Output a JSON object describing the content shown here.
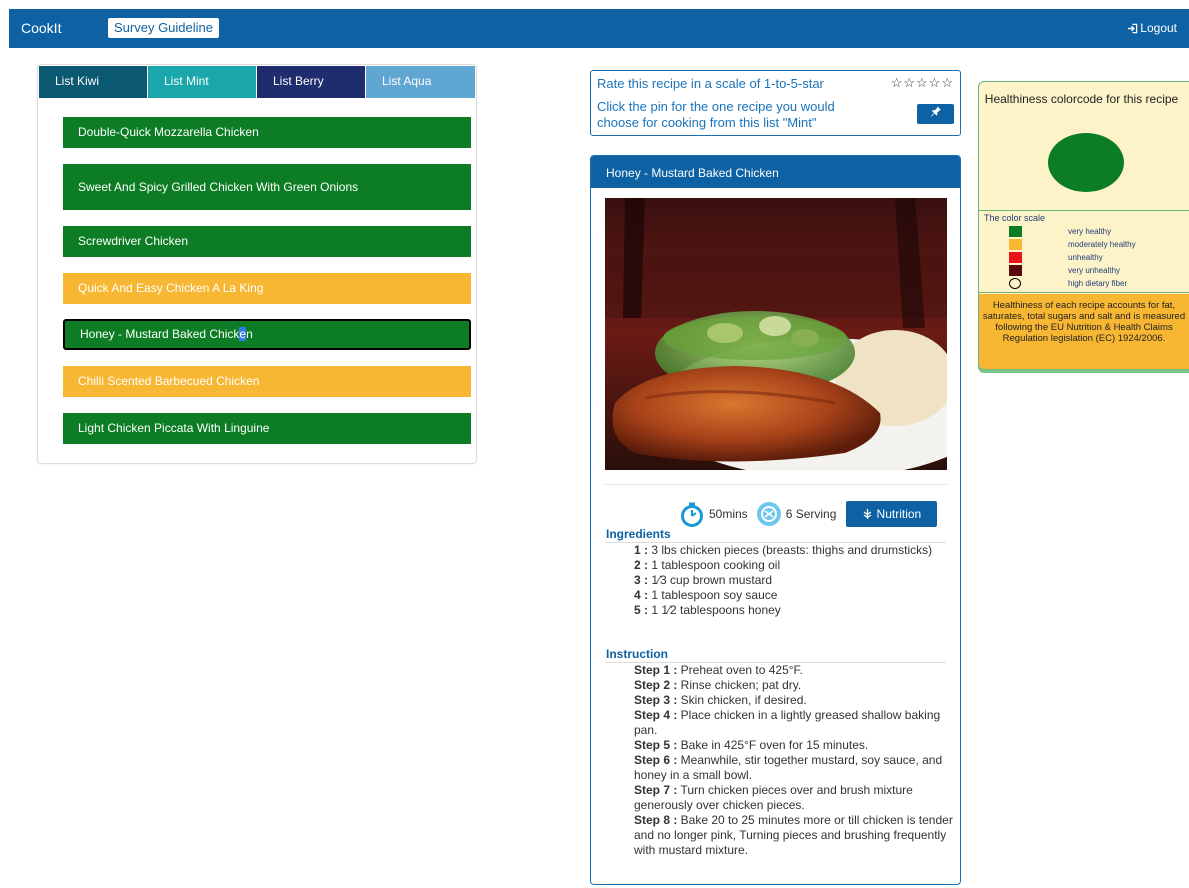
{
  "navbar": {
    "brand": "CookIt",
    "guideline_label": "Survey Guideline",
    "logout_label": "Logout"
  },
  "tabs": [
    {
      "label": "List Kiwi"
    },
    {
      "label": "List Mint"
    },
    {
      "label": "List Berry"
    },
    {
      "label": "List Aqua"
    }
  ],
  "recipes": [
    {
      "name": "Double-Quick Mozzarella Chicken",
      "health": "very healthy"
    },
    {
      "name": "Sweet And Spicy Grilled Chicken With Green Onions",
      "health": "very healthy"
    },
    {
      "name": "Screwdriver Chicken",
      "health": "very healthy"
    },
    {
      "name": "Quick And Easy Chicken A La King",
      "health": "moderately healthy"
    },
    {
      "name_part1": "Honey - Mustard Baked Chick",
      "name_highlight": "e",
      "name_part2": "n",
      "health": "very healthy",
      "selected": true
    },
    {
      "name": "Chilli Scented Barbecued Chicken",
      "health": "moderately healthy"
    },
    {
      "name": "Light Chicken Piccata With Linguine",
      "health": "very healthy"
    }
  ],
  "rating": {
    "prompt": "Rate this recipe in a scale of 1-to-5-star",
    "stars": "☆☆☆☆☆",
    "pin_prompt": "Click the pin for the one recipe you would choose for cooking from this list \"Mint\""
  },
  "recipe_card": {
    "title": "Honey - Mustard Baked Chicken",
    "time": "50mins",
    "servings": "6 Serving",
    "nutrition_label": "Nutrition",
    "ingredients_title": "Ingredients",
    "ingredients": [
      {
        "num": "1 :",
        "text": " 3 lbs chicken pieces (breasts: thighs and drumsticks)"
      },
      {
        "num": "2 :",
        "text": " 1 tablespoon cooking oil"
      },
      {
        "num": "3 :",
        "text": " 1⁄3 cup brown mustard"
      },
      {
        "num": "4 :",
        "text": " 1 tablespoon soy sauce"
      },
      {
        "num": "5 :",
        "text": " 1 1⁄2 tablespoons honey"
      }
    ],
    "instruction_title": "Instruction",
    "steps": [
      {
        "num": "Step 1 :",
        "text": " Preheat oven to 425°F."
      },
      {
        "num": "Step 2 :",
        "text": " Rinse chicken; pat dry."
      },
      {
        "num": "Step 3 :",
        "text": " Skin chicken, if desired."
      },
      {
        "num": "Step 4 :",
        "text": " Place chicken in a lightly greased shallow baking pan."
      },
      {
        "num": "Step 5 :",
        "text": " Bake in 425°F oven for 15 minutes."
      },
      {
        "num": "Step 6 :",
        "text": " Meanwhile, stir together mustard, soy sauce, and honey in a small bowl."
      },
      {
        "num": "Step 7 :",
        "text": " Turn chicken pieces over and brush mixture generously over chicken pieces."
      },
      {
        "num": "Step 8 :",
        "text": " Bake 20 to 25 minutes more or till chicken is tender and no longer pink, Turning pieces and brushing frequently with mustard mixture."
      }
    ]
  },
  "health": {
    "title": "Healthiness colorcode for this recipe",
    "current_color": "#0c7d24",
    "scale_label": "The color scale",
    "scale": [
      {
        "color": "#0c7d24",
        "label": "very healthy"
      },
      {
        "color": "#f7b733",
        "label": "moderately healthy"
      },
      {
        "color": "#e8141a",
        "label": "unhealthy"
      },
      {
        "color": "#5a0a0a",
        "label": "very unhealthy"
      },
      {
        "color": "circle",
        "label": "high dietary fiber"
      }
    ],
    "note": "Healthiness of each recipe accounts for fat, saturates, total sugars and salt and is measured following the EU Nutrition & Health Claims Regulation legislation (EC) 1924/2006."
  }
}
